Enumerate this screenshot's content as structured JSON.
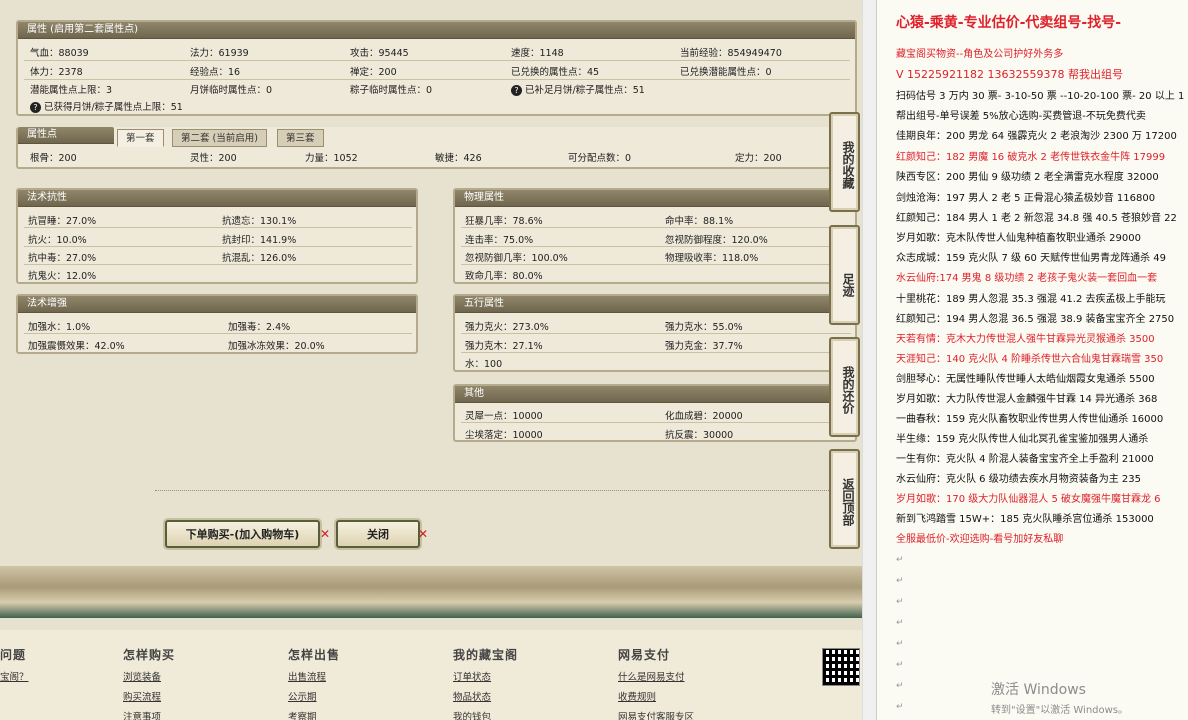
{
  "attr_panel": {
    "title": "属性 (启用第二套属性点)",
    "rows": [
      [
        "气血：88039",
        "法力：61939",
        "攻击：95445",
        "速度：1148",
        "当前经验：854949470"
      ],
      [
        "体力：2378",
        "经验点：16",
        "禅定：200",
        "已兑换的属性点：45",
        "已兑换潜能属性点：0"
      ],
      [
        "潜能属性点上限：3",
        "月饼临时属性点：0",
        "粽子临时属性点：0",
        "已补足月饼/粽子属性点：51"
      ]
    ],
    "note": "已获得月饼/粽子属性点上限：51"
  },
  "points_panel": {
    "title": "属性点",
    "tabs": [
      "第一套",
      "第二套 (当前启用)",
      "第三套"
    ],
    "values": [
      "根骨：200",
      "灵性：200",
      "力量：1052",
      "敏捷：426",
      "可分配点数：0",
      "定力：200"
    ]
  },
  "resist_panel": {
    "title": "法术抗性",
    "items": [
      "抗冒睡：27.0%",
      "抗遗忘：130.1%",
      "抗火：10.0%",
      "抗封印：141.9%",
      "抗中毒：27.0%",
      "抗混乱：126.0%",
      "抗鬼火：12.0%"
    ]
  },
  "phys_panel": {
    "title": "物理属性",
    "items": [
      "狂暴几率：78.6%",
      "命中率：88.1%",
      "连击率：75.0%",
      "忽视防御程度：120.0%",
      "忽视防御几率：100.0%",
      "物理吸收率：118.0%",
      "致命几率：80.0%"
    ]
  },
  "boost_panel": {
    "title": "法术增强",
    "items": [
      "加强水：1.0%",
      "加强毒：2.4%",
      "加强震慑效果：42.0%",
      "加强冰冻效果：20.0%"
    ]
  },
  "elem_panel": {
    "title": "五行属性",
    "items": [
      "强力克火：273.0%",
      "强力克水：55.0%",
      "强力克木：27.1%",
      "强力克金：37.7%",
      "水：100"
    ]
  },
  "other_panel": {
    "title": "其他",
    "items": [
      "灵犀一点：10000",
      "化血成碧：20000",
      "尘埃落定：10000",
      "抗反震：30000"
    ]
  },
  "buttons": {
    "buy": "下单购买-(加入购物车)",
    "close": "关闭"
  },
  "side_tabs": [
    "我的收藏",
    "足迹",
    "我的还价",
    "返回顶部"
  ],
  "footer": {
    "cols": [
      {
        "head": "问题",
        "links": [
          "宝阁？"
        ]
      },
      {
        "head": "怎样购买",
        "links": [
          "浏览装备",
          "购买流程",
          "注意事项"
        ]
      },
      {
        "head": "怎样出售",
        "links": [
          "出售流程",
          "公示期",
          "考察期"
        ]
      },
      {
        "head": "我的藏宝阁",
        "links": [
          "订单状态",
          "物品状态",
          "我的钱包"
        ]
      },
      {
        "head": "网易支付",
        "links": [
          "什么是网易支付",
          "收费规则",
          "网易支付客服专区"
        ]
      }
    ]
  },
  "ad": {
    "lines": [
      {
        "t": "心猿-乘黄-专业估价-代卖组号-找号-",
        "c": "big"
      },
      {
        "t": "藏宝阁买物资--角色及公司护好外务多",
        "c": "red"
      },
      {
        "t": "V 15225921182  13632559378 帮我出组号",
        "c": "red"
      },
      {
        "t": "扫码估号 3 万内 30 票- 3-10-50 票  --10-20-100 票- 20 以上 1",
        "c": ""
      },
      {
        "t": "帮出组号-单号误差 5%放心选购-买费管退-不玩免费代卖",
        "c": ""
      },
      {
        "t": "佳期良年：200 男龙 64 强霹克火 2 老浪淘沙 2300 万 17200",
        "c": ""
      },
      {
        "t": "红颜知己：182 男魔 16 破克水 2 老传世铁衣金牛阵 17999",
        "c": "red"
      },
      {
        "t": "陕西专区：200 男仙 9 级功绩 2 老全满雷克水程度 32000",
        "c": ""
      },
      {
        "t": "剑烛沧海：197 男人 2 老 5 正骨混心猿孟极妙音 116800",
        "c": ""
      },
      {
        "t": "红颜知己：184 男人 1 老 2 新忽混 34.8 强 40.5 苍狼妙音 22",
        "c": ""
      },
      {
        "t": "岁月如歌：克木队传世人仙鬼种植畜牧职业通杀 29000",
        "c": ""
      },
      {
        "t": "众志成城：159 克火队 7 级 60 天赋传世仙男青龙阵通杀 49",
        "c": ""
      },
      {
        "t": "水云仙府:174 男鬼 8 级功绩 2 老孩子鬼火装一套回血一套",
        "c": "red"
      },
      {
        "t": "十里桃花：189 男人忽混 35.3 强混 41.2 去疾孟极上手能玩",
        "c": ""
      },
      {
        "t": "红颜知己：194 男人忽混 36.5 强混 38.9 装备宝宝齐全 2750",
        "c": ""
      },
      {
        "t": "天若有情：克木大力传世混人强牛甘霖异光灵猴通杀 3500",
        "c": "red"
      },
      {
        "t": "天涯知己：140 克火队 4 阶睡杀传世六合仙鬼甘霖瑞雪 350",
        "c": "red"
      },
      {
        "t": "剑胆琴心：无属性睡队传世睡人太皓仙烟霞女鬼通杀 5500",
        "c": ""
      },
      {
        "t": "岁月如歌：大力队传世混人金麟强牛甘霖 14 异光通杀 368",
        "c": ""
      },
      {
        "t": "一曲春秋：159 克火队畜牧职业传世男人传世仙通杀 16000",
        "c": ""
      },
      {
        "t": "半生缘：159 克火队传世人仙北冥孔雀宝鉴加强男人通杀",
        "c": ""
      },
      {
        "t": "一生有你：克火队 4 阶混人装备宝宝齐全上手盈利 21000",
        "c": ""
      },
      {
        "t": "水云仙府：克火队 6 级功绩去疾水月物资装备为主 235",
        "c": ""
      },
      {
        "t": "岁月如歌：170 级大力队仙器混人 5 破女魔强牛魔甘霖龙 6",
        "c": "red"
      },
      {
        "t": "新到飞鸿踏雪 15W+：185 克火队睡杀宫位通杀 153000",
        "c": ""
      },
      {
        "t": "全服最低价-欢迎选购-看号加好友私聊",
        "c": "red"
      }
    ],
    "watermark": "激活 Windows",
    "watermark_sub": "转到\"设置\"以激活 Windows。"
  }
}
